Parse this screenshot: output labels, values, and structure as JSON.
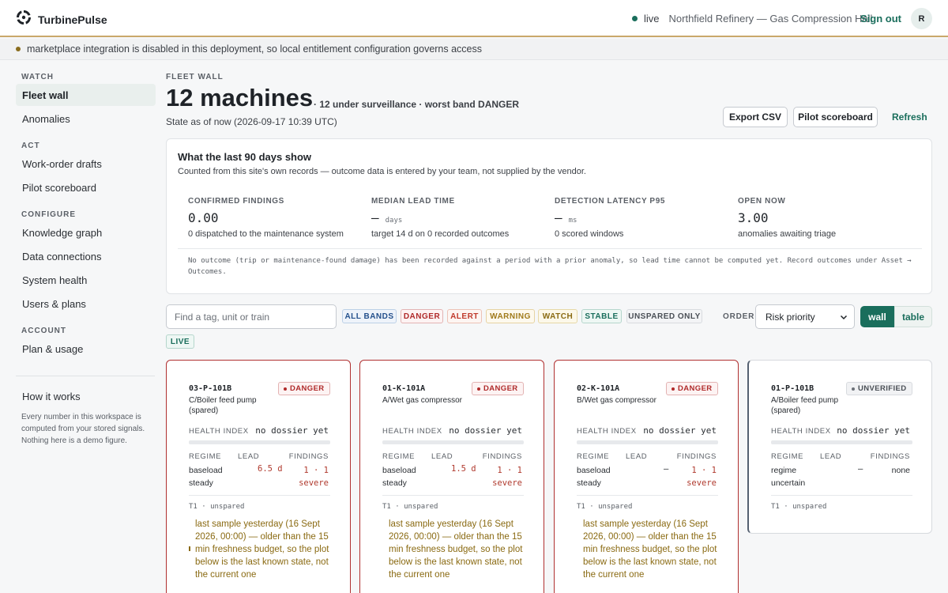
{
  "header": {
    "brand": "TurbinePulse",
    "live_label": "live",
    "site": "Northfield Refinery — Gas Compression Hall",
    "sign_out": "Sign out",
    "avatar_initial": "R"
  },
  "notice": "marketplace integration is disabled in this deployment, so local entitlement configuration governs access",
  "sidebar": {
    "sections": [
      {
        "title": "WATCH",
        "items": [
          "Fleet wall",
          "Anomalies"
        ]
      },
      {
        "title": "ACT",
        "items": [
          "Work-order drafts",
          "Pilot scoreboard"
        ]
      },
      {
        "title": "CONFIGURE",
        "items": [
          "Knowledge graph",
          "Data connections",
          "System health",
          "Users & plans"
        ]
      },
      {
        "title": "ACCOUNT",
        "items": [
          "Plan & usage"
        ]
      }
    ],
    "active_item": "Fleet wall",
    "how_it_works": "How it works",
    "how_note": "Every number in this workspace is computed from your stored signals. Nothing here is a demo figure."
  },
  "main": {
    "eyebrow": "FLEET WALL",
    "title": "12 machines",
    "subtitle": "· 12 under surveillance · worst band DANGER",
    "state_line": "State as of now (2026-09-17 10:39 UTC)",
    "buttons": {
      "export": "Export CSV",
      "scoreboard": "Pilot scoreboard",
      "refresh": "Refresh"
    }
  },
  "summary": {
    "title": "What the last 90 days show",
    "desc": "Counted from this site's own records — outcome data is entered by your team, not supplied by the vendor.",
    "kpis": [
      {
        "label": "CONFIRMED FINDINGS",
        "value": "0.00",
        "unit": "",
        "note": "0 dispatched to the maintenance system"
      },
      {
        "label": "MEDIAN LEAD TIME",
        "value": "—",
        "unit": "days",
        "note": "target 14 d on 0 recorded outcomes"
      },
      {
        "label": "DETECTION LATENCY P95",
        "value": "—",
        "unit": "ms",
        "note": "0 scored windows"
      },
      {
        "label": "OPEN NOW",
        "value": "3.00",
        "unit": "",
        "note": "anomalies awaiting triage"
      }
    ],
    "footnote": "No outcome (trip or maintenance-found damage) has been recorded against a period with a prior anomaly, so lead time cannot be computed yet. Record outcomes under Asset → Outcomes."
  },
  "filters": {
    "search_placeholder": "Find a tag, unit or train",
    "chips": [
      "ALL BANDS",
      "DANGER",
      "ALERT",
      "WARNING",
      "WATCH",
      "STABLE",
      "UNSPARED ONLY",
      "LIVE"
    ],
    "order_label": "ORDER",
    "order_value": "Risk priority",
    "view_wall": "wall",
    "view_table": "table"
  },
  "colors": {
    "accent": "#1a6e5c",
    "danger": "#b02a2a",
    "alert": "#c0392b",
    "warning": "#a07a1a",
    "stale_text": "#8a6a12"
  },
  "cards": [
    {
      "tag": "03-P-101B",
      "name": "C/Boiler feed pump (spared)",
      "badge": "DANGER",
      "health_label": "HEALTH INDEX",
      "health_value": "no dossier yet",
      "col_regime": "REGIME",
      "col_lead": "LEAD",
      "col_findings": "FINDINGS",
      "regime": "baseload steady",
      "lead": "6.5 d",
      "findings": "1 · 1 severe",
      "tier": "T1 · unspared",
      "stale": "last sample yesterday (16 Sept 2026, 00:00) — older than the 15 min freshness budget, so the plot below is the last known state, not the current one"
    },
    {
      "tag": "01-K-101A",
      "name": "A/Wet gas compressor",
      "badge": "DANGER",
      "health_label": "HEALTH INDEX",
      "health_value": "no dossier yet",
      "col_regime": "REGIME",
      "col_lead": "LEAD",
      "col_findings": "FINDINGS",
      "regime": "baseload steady",
      "lead": "1.5 d",
      "findings": "1 · 1 severe",
      "tier": "T1 · unspared",
      "stale": "last sample yesterday (16 Sept 2026, 00:00) — older than the 15 min freshness budget, so the plot below is the last known state, not the current one"
    },
    {
      "tag": "02-K-101A",
      "name": "B/Wet gas compressor",
      "badge": "DANGER",
      "health_label": "HEALTH INDEX",
      "health_value": "no dossier yet",
      "col_regime": "REGIME",
      "col_lead": "LEAD",
      "col_findings": "FINDINGS",
      "regime": "baseload steady",
      "lead": "—",
      "findings": "1 · 1 severe",
      "tier": "T1 · unspared",
      "stale": "last sample yesterday (16 Sept 2026, 00:00) — older than the 15 min freshness budget, so the plot below is the last known state, not the current one"
    },
    {
      "tag": "01-P-101B",
      "name": "A/Boiler feed pump (spared)",
      "badge": "UNVERIFIED",
      "health_label": "HEALTH INDEX",
      "health_value": "no dossier yet",
      "col_regime": "REGIME",
      "col_lead": "LEAD",
      "col_findings": "FINDINGS",
      "regime": "regime uncertain",
      "lead": "—",
      "findings": "none",
      "tier": "T1 · unspared"
    }
  ]
}
